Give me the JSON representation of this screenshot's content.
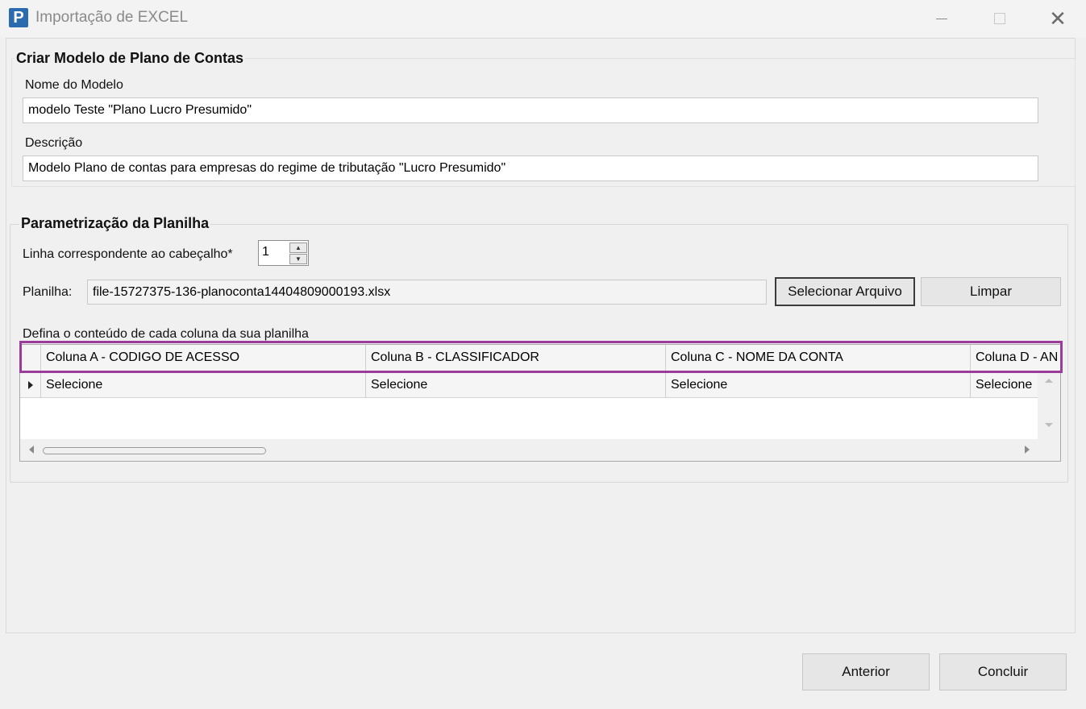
{
  "window": {
    "title": "Importação de EXCEL",
    "app_icon_letter": "P"
  },
  "modelo": {
    "group_title": "Criar Modelo de Plano de Contas",
    "nome_label": "Nome do Modelo",
    "nome_value": "modelo Teste \"Plano Lucro Presumido\"",
    "descricao_label": "Descrição",
    "descricao_value": "Modelo Plano de contas para empresas do regime de tributação \"Lucro Presumido\""
  },
  "parametrizacao": {
    "group_title": "Parametrização da Planilha",
    "cabecalho_label": "Linha correspondente ao cabeçalho*",
    "cabecalho_value": "1",
    "planilha_label": "Planilha:",
    "planilha_value": "file-15727375-136-planoconta14404809000193.xlsx",
    "select_button": "Selecionar Arquivo",
    "clear_button": "Limpar",
    "grid_label": "Defina o conteúdo de cada coluna da sua planilha"
  },
  "grid": {
    "columns": [
      "Coluna A - CODIGO DE ACESSO",
      "Coluna B - CLASSIFICADOR",
      "Coluna C - NOME DA CONTA",
      "Coluna D - AN"
    ],
    "row": [
      "Selecione",
      "Selecione",
      "Selecione",
      "Selecione"
    ]
  },
  "footer": {
    "back_button": "Anterior",
    "finish_button": "Concluir"
  },
  "colors": {
    "highlight": "#9b3c9b",
    "app_icon": "#2b6cb0"
  }
}
